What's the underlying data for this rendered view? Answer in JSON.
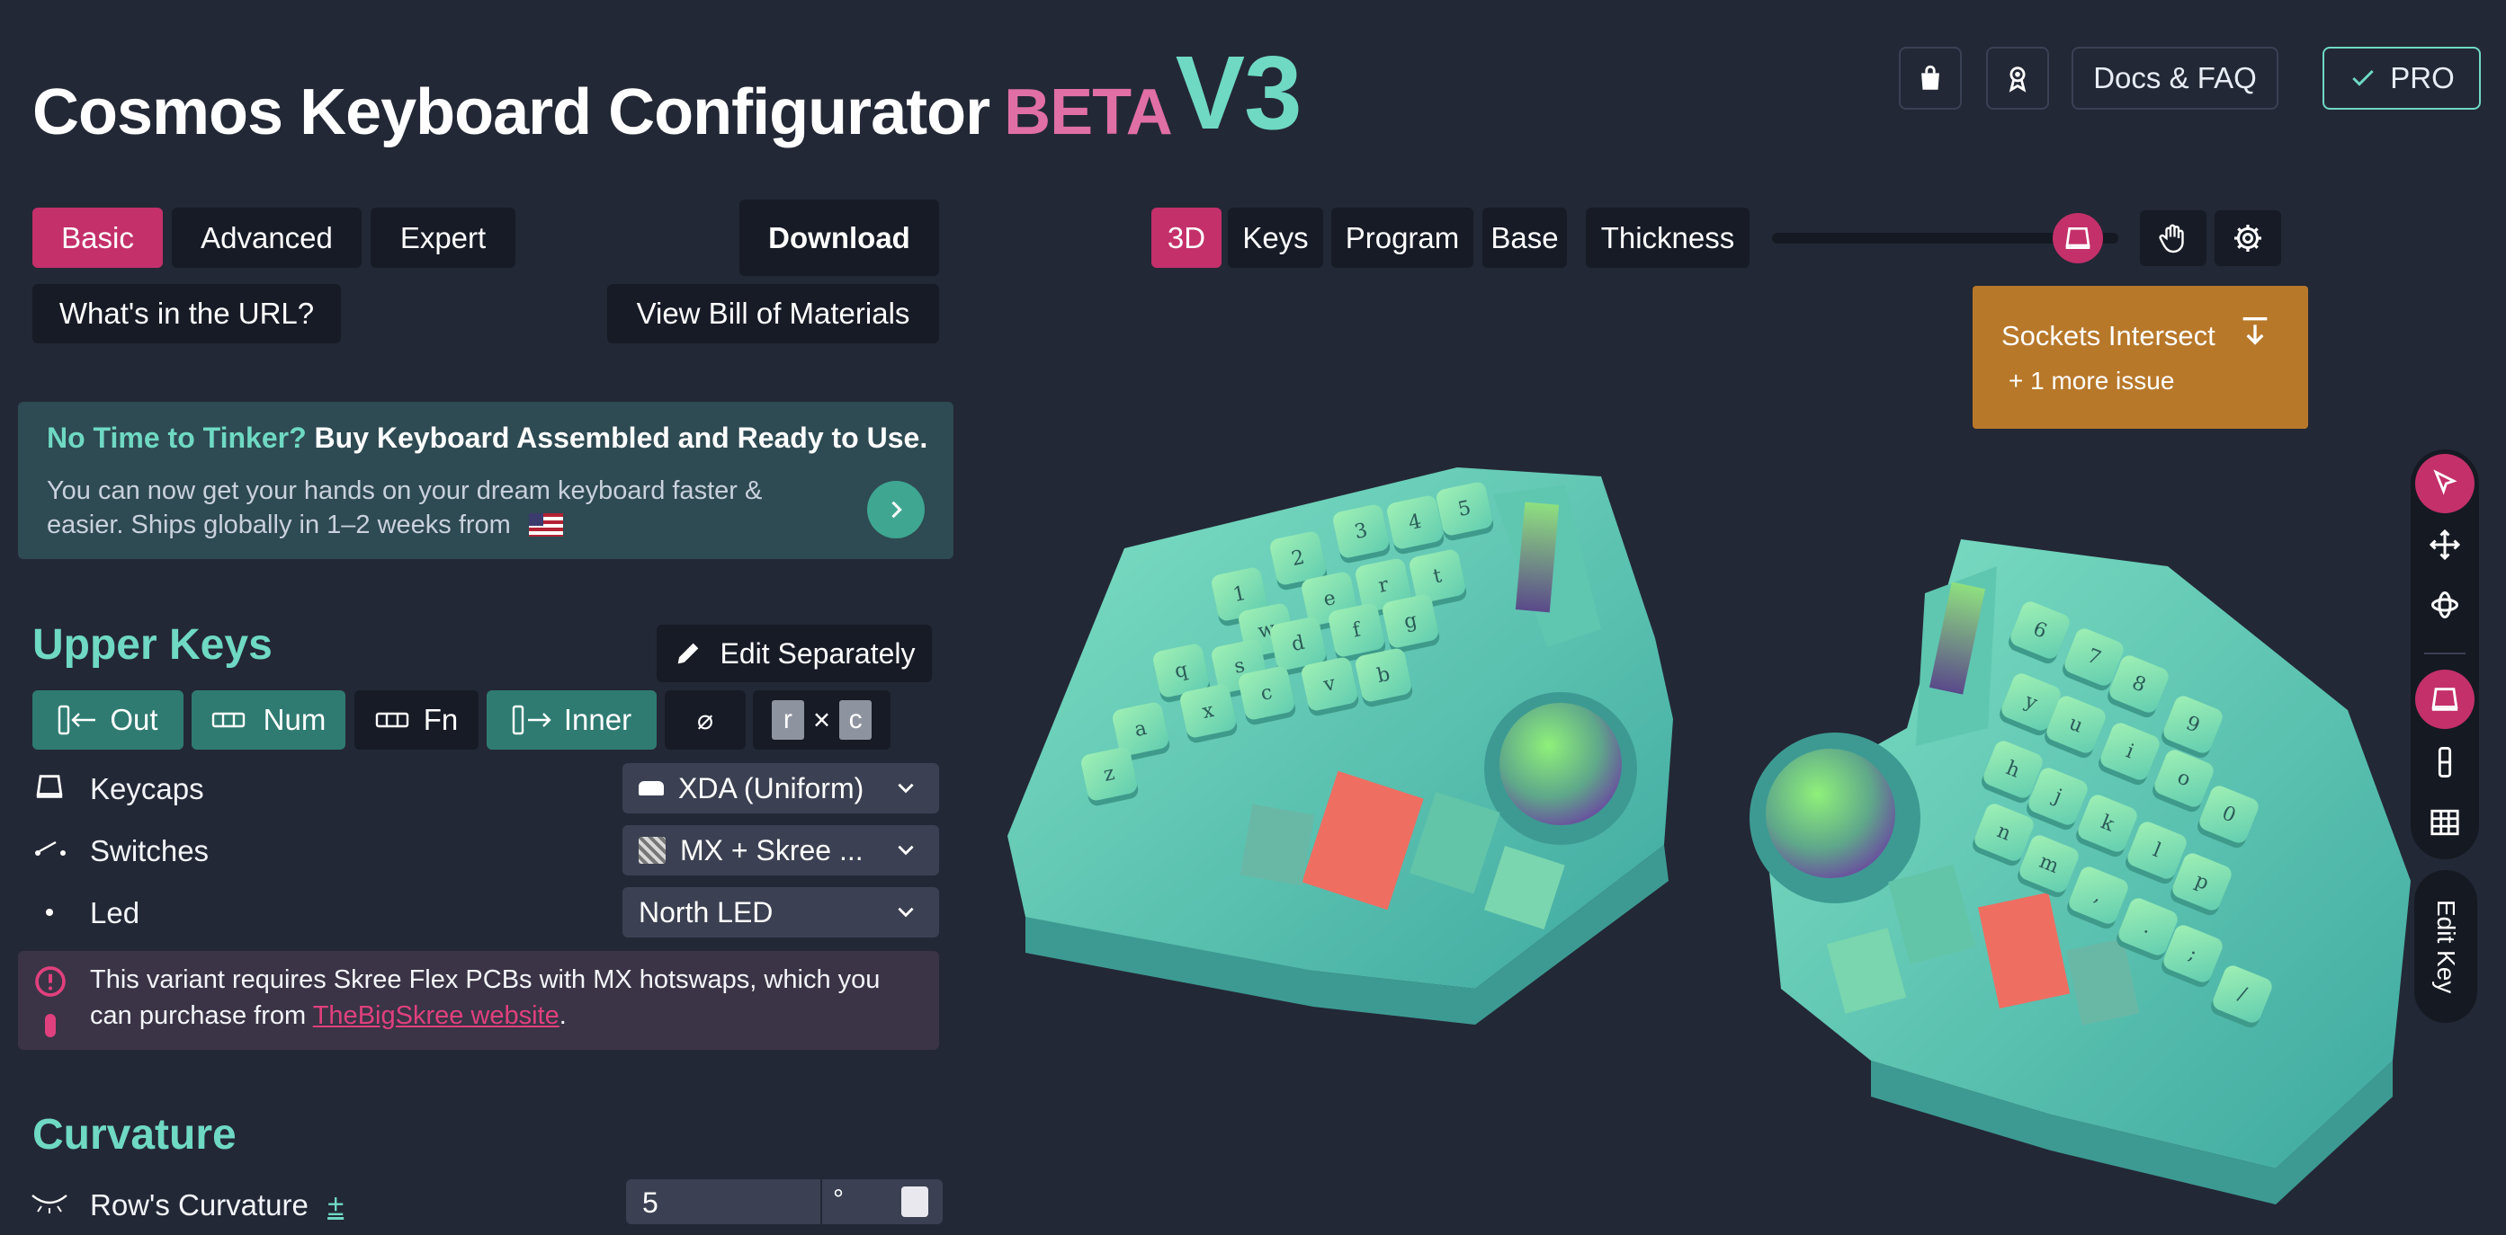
{
  "header": {
    "title": "Cosmos Keyboard Configurator",
    "beta": "BETA",
    "version": "V3",
    "docs": "Docs & FAQ",
    "pro": "PRO"
  },
  "modes": {
    "basic": "Basic",
    "advanced": "Advanced",
    "expert": "Expert",
    "download": "Download",
    "url": "What's in the URL?",
    "bom": "View Bill of Materials"
  },
  "promo": {
    "highlight": "No Time to Tinker?",
    "title": "Buy Keyboard Assembled and Ready to Use.",
    "body1": "You can now get your hands on your dream keyboard faster &",
    "body2": "easier. Ships globally in 1–2 weeks from",
    "flag": "🇺🇸"
  },
  "upper_keys": {
    "heading": "Upper Keys",
    "edit": "Edit Separately",
    "toggles": {
      "out": "Out",
      "num": "Num",
      "fn": "Fn",
      "inner": "Inner",
      "none": "⌀",
      "r": "r",
      "x": "×",
      "c": "c"
    },
    "keycaps_label": "Keycaps",
    "keycaps_value": "XDA (Uniform)",
    "switches_label": "Switches",
    "switches_value": "MX + Skree ...",
    "led_label": "Led",
    "led_value": "North LED",
    "notice1": "This variant requires Skree Flex PCBs with MX hotswaps, which you",
    "notice2": "can purchase from",
    "notice_link": "TheBigSkree website",
    "notice_end": "."
  },
  "curvature": {
    "heading": "Curvature",
    "row_label": "Row's Curvature",
    "plusminus": "±",
    "value": "5",
    "unit": "°"
  },
  "viewer_tabs": {
    "3d": "3D",
    "keys": "Keys",
    "program": "Program",
    "base": "Base",
    "thickness": "Thickness"
  },
  "slider": {
    "value": 0.85
  },
  "warning": {
    "title": "Sockets Intersect",
    "more": "+ 1 more issue"
  },
  "edit_key": "Edit Key",
  "left_keys": [
    "1",
    "2",
    "3",
    "4",
    "5",
    "w",
    "e",
    "r",
    "t",
    "q",
    "s",
    "d",
    "f",
    "g",
    "a",
    "x",
    "c",
    "v",
    "b",
    "z"
  ],
  "right_keys": [
    "6",
    "7",
    "8",
    "9",
    "y",
    "u",
    "i",
    "o",
    "0",
    "h",
    "j",
    "k",
    "l",
    "p",
    "n",
    "m",
    ",",
    ".",
    ";",
    "/"
  ],
  "colors": {
    "accent_pink": "#c4306a",
    "teal": "#6fd9c3",
    "beta_pink": "#e06fa5",
    "warning_bg": "#b8782a"
  }
}
